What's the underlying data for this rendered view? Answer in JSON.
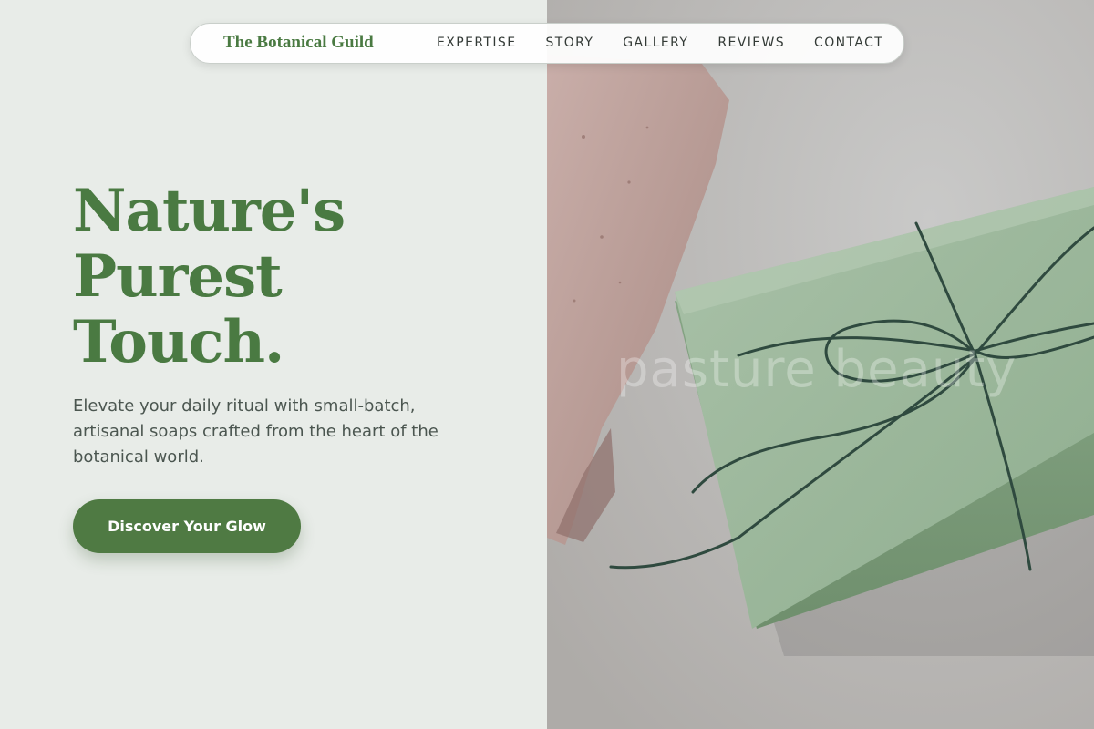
{
  "nav": {
    "brand": "The Botanical Guild",
    "links": [
      "EXPERTISE",
      "STORY",
      "GALLERY",
      "REVIEWS",
      "CONTACT"
    ]
  },
  "hero": {
    "title_lines": [
      "Nature's",
      "Purest",
      "Touch."
    ],
    "subtitle": "Elevate your daily ritual with small-batch, artisanal soaps crafted from the heart of the botanical world.",
    "cta_label": "Discover Your Glow"
  },
  "image": {
    "watermark": "pasture beauty",
    "subject": "soap-bars-photo"
  },
  "colors": {
    "brand_green": "#4a7a42",
    "button_green": "#4f7a43",
    "panel_bg": "#e8ece8",
    "text_gray": "#4b5650"
  }
}
